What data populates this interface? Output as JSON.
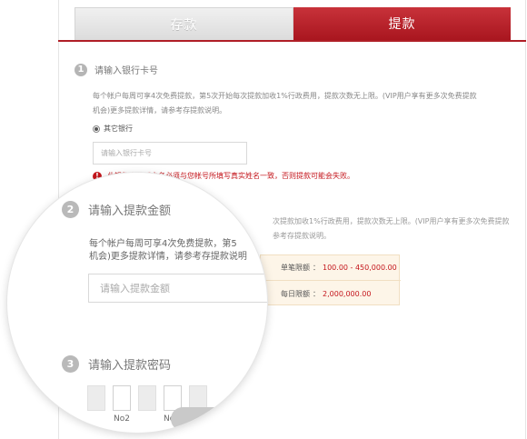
{
  "tabs": [
    {
      "label": "存款"
    },
    {
      "label": "提款"
    }
  ],
  "step1": {
    "num": "1",
    "title": "请输入银行卡号",
    "desc_line1": "每个帐户每周可享4次免费提款，第5次开始每次提款加收1%行政费用，提款次数无上限。(VIP用户享有更多次免费提款",
    "desc_line2": "机会)更多提款详情，请参考存提款说明。",
    "radio_label": "其它银行",
    "input_placeholder": "请输入银行卡号",
    "warning": "此银行卡的开户名必须与您帐号所填写真实姓名一致，否则提款可能会失败。"
  },
  "background": {
    "desc_line1": "次提款加收1%行政费用，提款次数无上限。(VIP用户享有更多次免费提款",
    "desc_line2": "参考存提款说明。"
  },
  "limits": {
    "single_label": "单笔限额",
    "single_value": "100.00 - 450,000.00",
    "daily_label": "每日限额",
    "daily_value": "2,000,000.00",
    "colon": "："
  },
  "magnifier": {
    "step2": {
      "num": "2",
      "title": "请输入提款金额",
      "desc_line1": "每个帐户每周可享4次免费提款，第5",
      "desc_line2": "机会)更多提款详情，请参考存提款说明",
      "input_placeholder": "请输入提款金额"
    },
    "step3": {
      "num": "3",
      "title": "请输入提款密码",
      "label_no2": "No2",
      "label_no4": "No4"
    }
  }
}
